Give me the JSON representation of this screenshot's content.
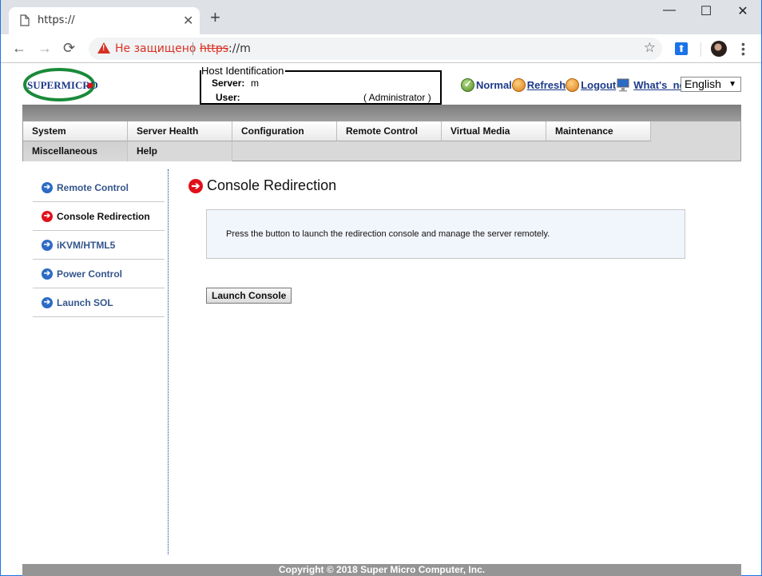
{
  "browser": {
    "tab_title": "https://",
    "security_label": "Не защищено",
    "url_scheme": "https",
    "url_rest": "://m",
    "controls": {
      "back": "←",
      "forward": "→",
      "reload": "⟳",
      "star": "☆",
      "new_tab": "+",
      "close_tab": "✕",
      "minimize": "—",
      "maximize": "☐",
      "close_window": "✕",
      "menu": "⋮",
      "extension": "⬆"
    }
  },
  "header": {
    "logo_text": "SUPERMICRO",
    "host_identification": {
      "legend": "Host Identification",
      "server_label": "Server:",
      "server_value": "m",
      "user_label": "User:",
      "user_value": "( Administrator )"
    },
    "status": {
      "normal_label": "Normal",
      "refresh_label": "Refresh",
      "logout_label": "Logout",
      "whats_new_label": "What's_new"
    },
    "language": {
      "selected": "English",
      "arrow": "▼"
    }
  },
  "nav": {
    "row1": [
      "System",
      "Server Health",
      "Configuration",
      "Remote Control",
      "Virtual Media",
      "Maintenance"
    ],
    "row2": [
      "Miscellaneous",
      "Help"
    ]
  },
  "sidebar": {
    "items": [
      {
        "label": "Remote Control",
        "active": false
      },
      {
        "label": "Console Redirection",
        "active": true
      },
      {
        "label": "iKVM/HTML5",
        "active": false
      },
      {
        "label": "Power Control",
        "active": false
      },
      {
        "label": "Launch SOL",
        "active": false
      }
    ]
  },
  "main": {
    "title": "Console Redirection",
    "info_message": "Press the button to launch the redirection console and manage the server remotely.",
    "launch_button": "Launch Console"
  },
  "footer": {
    "copyright": "Copyright © 2018 Super Micro Computer, Inc."
  },
  "colors": {
    "active_arrow": "#e0101a",
    "inactive_arrow": "#2c6bc5",
    "link": "#1c3a8a",
    "insecure": "#d93025"
  }
}
